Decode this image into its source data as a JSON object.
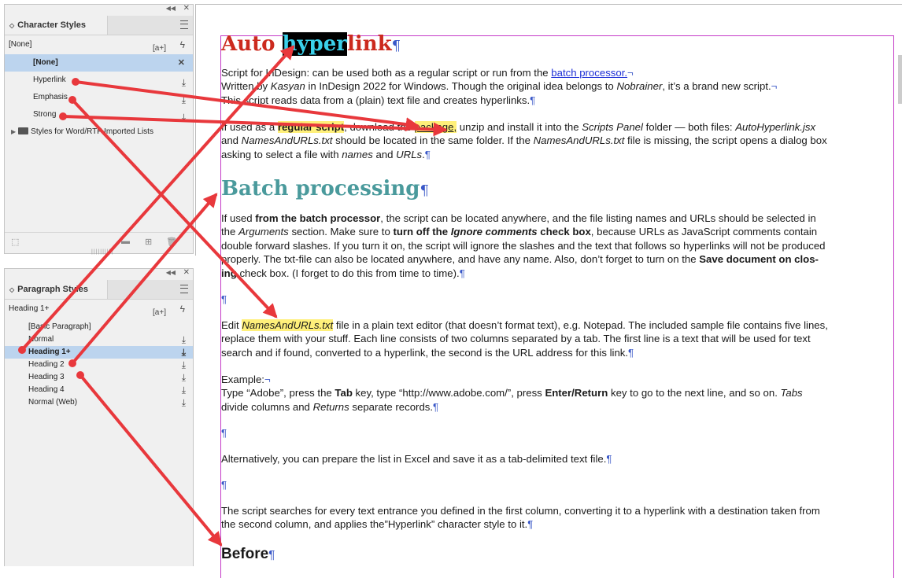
{
  "char_panel": {
    "title": "Character Styles",
    "current": "[None]",
    "styles": [
      "[None]",
      "Hyperlink",
      "Emphasis",
      "Strong"
    ],
    "group": "Styles for Word/RTF Imported Lists",
    "new_style_btn": "[a+]"
  },
  "para_panel": {
    "title": "Paragraph Styles",
    "current": "Heading 1+",
    "styles": [
      "[Basic Paragraph]",
      "Normal",
      "Heading 1+",
      "Heading 2",
      "Heading 3",
      "Heading 4",
      "Normal (Web)"
    ],
    "new_style_btn": "[a+]"
  },
  "doc": {
    "h1": {
      "pre": "Auto",
      "sel": "hyper",
      "post": "link"
    },
    "p1": {
      "l1a": "Script for InDesign: can be used both as a regular script or run from the ",
      "l1link": "batch processor.",
      "l2a": "Written by ",
      "l2b": "Kasyan",
      "l2c": " in InDesign 2022 for Windows. Though the original idea belongs to ",
      "l2d": "Nobrainer",
      "l2e": ", it’s a brand new script.",
      "l3": "This script reads data from a (plain) text file and creates hyperlinks."
    },
    "p2": {
      "l1a": "If used as a ",
      "l1b": "regular script",
      "l1c": ", download the ",
      "l1d": "package,",
      "l1e": " unzip and install it into the ",
      "l1f": "Scripts Panel",
      "l1g": " folder — both files: ",
      "l1h": "AutoHyperlink.jsx",
      "l2a": "and ",
      "l2b": "NamesAndURLs.txt",
      "l2c": " should be located in the same folder. If the ",
      "l2d": "NamesAndURLs.txt",
      "l2e": " file is missing, the script opens a dialog box",
      "l3a": "asking to select a file with ",
      "l3b": "names",
      "l3c": " and ",
      "l3d": "URLs",
      "l3e": "."
    },
    "h1b": "Batch processing",
    "p3": {
      "l1a": "If used ",
      "l1b": "from the batch processor",
      "l1c": ", the script can be located anywhere, and the file listing names and URLs should be selected in",
      "l2a": "the ",
      "l2b": "Arguments",
      "l2c": " section. Make sure to ",
      "l2d": "turn off the ",
      "l2e": "Ignore comments",
      "l2f": " check box",
      "l2g": ", because URLs as JavaScript comments contain",
      "l3": "double forward slashes. If you turn it on, the script will ignore the slashes and the text that follows so hyperlinks will not be produced",
      "l4a": "properly. The txt-file can also be located anywhere, and have any name. Also, don’t forget to turn on the ",
      "l4b": "Save document on clos-",
      "l5a": "ing",
      "l5b": " check box. (I forget to do this from time to time)."
    },
    "p4": {
      "l1a": "Edit ",
      "l1b": "NamesAndURLs.txt",
      "l1c": " file in a plain text editor (that doesn’t format text), e.g. Notepad. The included sample file contains five lines,",
      "l2": "replace them with your stuff. Each line consists of two columns separated by a tab. The first line is a text that will be used for text",
      "l3": "search and if found, converted to a hyperlink, the second is the URL address for this link."
    },
    "p5": {
      "l1": "Example:",
      "l2a": "Type “Adobe”, press the ",
      "l2b": "Tab",
      "l2c": " key, type “http://www.adobe.com/”, press ",
      "l2d": "Enter/Return",
      "l2e": " key to go to the next line, and so on. ",
      "l2f": "Tabs",
      "l3a": "divide columns and ",
      "l3b": "Returns",
      "l3c": " separate records."
    },
    "p6": "Alternatively, you can prepare the list in Excel and save it as a tab-delimited text file.",
    "p7": {
      "l1": "The script searches for every text entrance you defined in the first column, converting it to a hyperlink with a destination taken from",
      "l2": "the second column, and applies the”Hyperlink” character style to it."
    },
    "h2": "Before"
  },
  "symbols": {
    "pilcrow": "¶",
    "lb": "¬"
  },
  "colors": {
    "arrow": "#e8383c",
    "heading_red": "#cc2a1e",
    "heading_teal": "#4a9a9c",
    "highlight": "#fff07a",
    "selection": "#bcd4ee"
  }
}
